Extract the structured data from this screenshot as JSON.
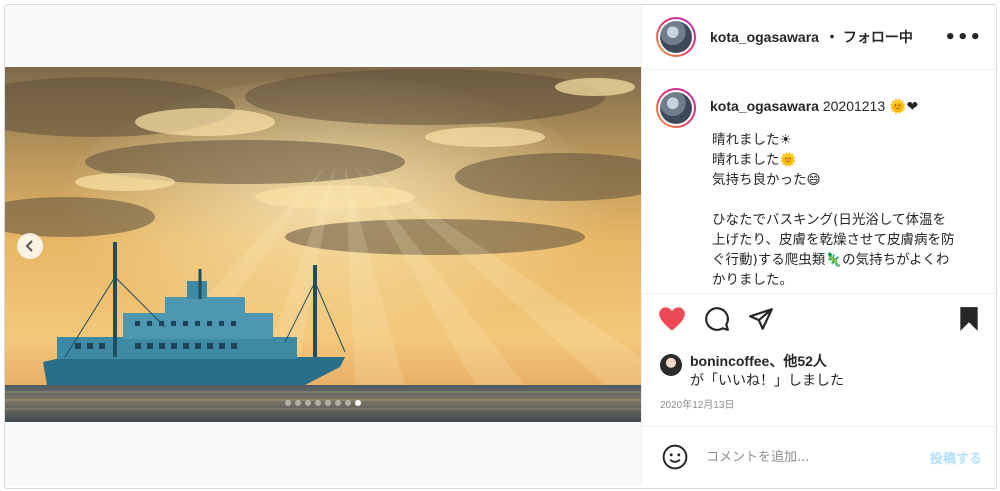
{
  "post": {
    "username": "kota_ogasawara",
    "follow_status": "・ フォロー中",
    "more_label": "•••"
  },
  "caption": {
    "username": "kota_ogasawara",
    "date_tag": "20201213",
    "header_emojis": "🌞❤",
    "lines": [
      "晴れました☀",
      "晴れました🌞",
      "気持ち良かった😄"
    ],
    "paragraph_lines": [
      "ひなたでバスキング(日光浴して体温を",
      "上げたり、皮膚を乾燥させて皮膚病を防",
      "ぐ行動)する爬虫類🦎の気持ちがよくわ",
      "かりました。"
    ]
  },
  "likes": {
    "names": "bonincoffee、他52人",
    "suffix": "が「いいね！」しました"
  },
  "timestamp": "2020年12月13日",
  "comment": {
    "placeholder": "コメントを追加...",
    "post_label": "投稿する"
  },
  "carousel": {
    "count": 8,
    "active_index": 7
  },
  "colors": {
    "like": "#ed4956",
    "post_button": "#b2dffc",
    "text": "#262626",
    "muted": "#8e8e8e"
  },
  "icons": [
    "chevron-left-icon",
    "heart-icon",
    "comment-icon",
    "share-icon",
    "bookmark-icon",
    "smiley-icon",
    "more-icon"
  ]
}
